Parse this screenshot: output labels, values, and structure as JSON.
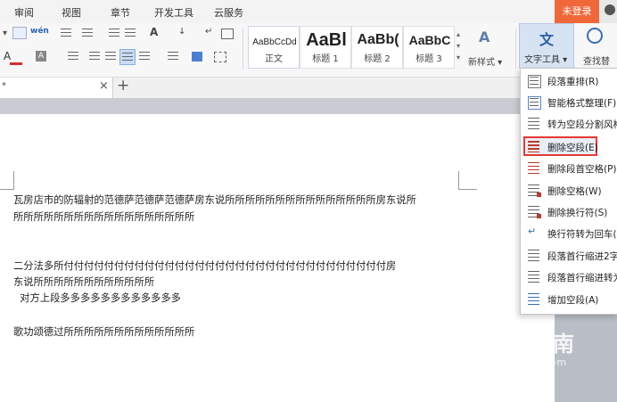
{
  "menubar": {
    "items": [
      "审阅",
      "视图",
      "章节",
      "开发工具",
      "云服务"
    ],
    "login_label": "未登录"
  },
  "ribbon": {
    "styles": [
      {
        "preview": "AaBbCcDd",
        "caption": "正文"
      },
      {
        "preview": "AaBl",
        "caption": "标题 1"
      },
      {
        "preview": "AaBb(",
        "caption": "标题 2"
      },
      {
        "preview": "AaBbC",
        "caption": "标题 3"
      }
    ],
    "new_style_label": "新样式",
    "text_tools_label": "文字工具",
    "find_label": "查找替"
  },
  "tabbar": {
    "close_glyph": "×",
    "new_tab_glyph": "+",
    "doc_tab_marker": "*"
  },
  "document": {
    "lines": [
      "瓦房店市的防辐射的范德萨范德萨范德萨房东说所所所所所所所所所所所所所所所房东说所",
      "所所所所所所所所所所所所所所所所所所",
      "二分法多所付付付付付付付付付付付付付付付付付付付付付付付付付付付付付付付付房",
      "东说所所所所所所所所所所所所",
      "  对方上段多多多多多多多多多多多多",
      "歌功颂德过所所所所所所所所所所所所所"
    ]
  },
  "dropdown": {
    "items": [
      {
        "label": "段落重排(R)",
        "icon": "paragraph-rearrange-icon"
      },
      {
        "label": "智能格式整理(F)",
        "icon": "smart-format-icon"
      },
      {
        "label": "转为空段分割风格",
        "icon": "split-style-icon"
      },
      {
        "label": "删除空段(E)",
        "icon": "delete-empty-paragraph-icon",
        "highlighted": true
      },
      {
        "label": "删除段首空格(P)",
        "icon": "delete-leading-space-icon"
      },
      {
        "label": "删除空格(W)",
        "icon": "delete-space-icon"
      },
      {
        "label": "删除换行符(S)",
        "icon": "delete-line-break-icon"
      },
      {
        "label": "换行符转为回车(L)",
        "icon": "line-break-to-enter-icon"
      },
      {
        "label": "段落首行缩进2字符",
        "icon": "indent-two-chars-icon"
      },
      {
        "label": "段落首行缩进转为空格",
        "icon": "indent-to-space-icon"
      },
      {
        "label": "增加空段(A)",
        "icon": "add-empty-paragraph-icon"
      }
    ]
  },
  "watermark": {
    "text": "搜狗指南",
    "url": "zhinan.sogou.com"
  },
  "colors": {
    "accent": "#f0683a",
    "highlight_border": "#e53935",
    "font_color_underline": "#d32f2f",
    "highlight_color": "#4a7fd4"
  }
}
